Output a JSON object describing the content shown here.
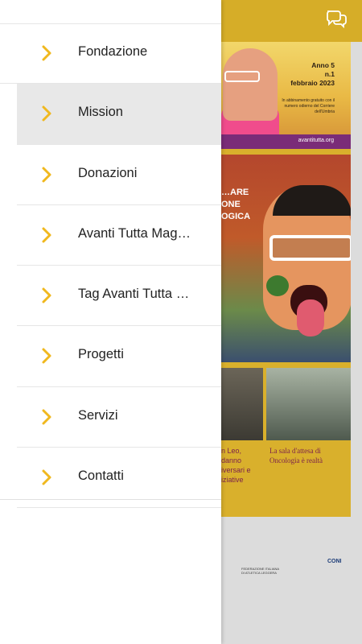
{
  "header": {
    "chat_icon": "chat-bubbles-icon",
    "accent": "#d6ad28"
  },
  "menu": {
    "chevron_color": "#f0b81e",
    "items": [
      {
        "label": "Fondazione",
        "active": false
      },
      {
        "label": "Mission",
        "active": true
      },
      {
        "label": "Donazioni",
        "active": false
      },
      {
        "label": "Avanti Tutta Mag…",
        "active": false
      },
      {
        "label": "Tag Avanti Tutta …",
        "active": false
      },
      {
        "label": "Progetti",
        "active": false
      },
      {
        "label": "Servizi",
        "active": false
      },
      {
        "label": "Contatti",
        "active": false
      }
    ]
  },
  "magazine": {
    "anno": "Anno 5",
    "numero": "n.1",
    "data": "febbraio 2023",
    "note": "In abbinamento gratuito con il numero odierno del Corriere dell'Umbria",
    "url": "avantitutta.org",
    "cover_words": "…ARE\nONE\nOGICA",
    "caption_left": "n Leo,\ndanno\niversari e\niziative",
    "caption_right": "La sala d'attesa di Oncologia è realtà",
    "logo_federation": "FEDERAZIONE ITALIANA DI ATLETICA LEGGERA",
    "logo_coni": "CONI"
  }
}
